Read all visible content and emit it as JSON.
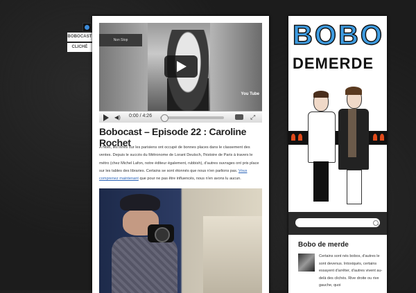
{
  "tags": {
    "items": [
      "BOBOCAST",
      "CLICHÉ"
    ]
  },
  "post": {
    "video": {
      "shop_sign": "Non Stop",
      "time": "0:00 / 4:26",
      "progress": 0,
      "logo": "You Tube"
    },
    "title": "Bobocast – Episode 22 : Caroline Rochet",
    "body_before_link": "A Noël, les livres sur les parisiens ont occupé de bonnes places dans le classement des ventes. Depuis le succès du Métronome de Lorant Deutsch, l'histoire de Paris à travers le métro (chez Michel Lafon, notre éditeur également, rubbish), d'autres ouvrages ont pris place sur les tables des libraries. Certains se sont étonnés que nous n'en parlions pas.",
    "link_text": "Vous comprenez maintenant",
    "body_after_link": " que pour ne pas être influencés, nous n'en avons lu aucun."
  },
  "sidebar": {
    "logo_line1": "BOBO",
    "logo_line2": "DEMERDE",
    "search": {
      "placeholder": ""
    },
    "about": {
      "title": "Bobo de merde",
      "text": "Certains sont nés bobos, d'autres le sont devenus. Intoxiqués, certains essayent d'arrêter, d'autres vivent au-delà des clichés. Rive droite ou rive gauche, quoi"
    }
  },
  "colors": {
    "background": "#1c1c1c",
    "logo_blue": "#3d9be0",
    "link": "#2b64b8",
    "tag_dot": "#3b8ad8"
  }
}
